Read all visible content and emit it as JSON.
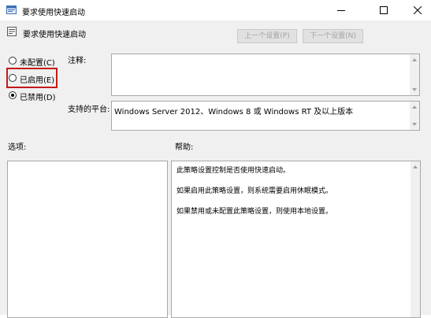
{
  "window": {
    "title": "要求使用快速启动",
    "controls": {
      "minimize": "minimize-icon",
      "maximize": "maximize-icon",
      "close": "close-icon"
    }
  },
  "header": {
    "policy_name": "要求使用快速启动",
    "prev_button": "上一个设置(P)",
    "next_button": "下一个设置(N)"
  },
  "state_options": [
    {
      "label": "未配置(C)",
      "checked": false
    },
    {
      "label": "已启用(E)",
      "checked": false
    },
    {
      "label": "已禁用(D)",
      "checked": true
    }
  ],
  "comment": {
    "label": "注释:",
    "value": ""
  },
  "supported": {
    "label": "支持的平台:",
    "value": "Windows Server 2012、Windows 8 或 Windows RT 及以上版本"
  },
  "options": {
    "label": "选项:"
  },
  "help": {
    "label": "帮助:",
    "lines": [
      "此策略设置控制是否使用快速启动。",
      "如果启用此策略设置，则系统需要启用休眠模式。",
      "如果禁用或未配置此策略设置，则使用本地设置。"
    ]
  },
  "colors": {
    "highlight": "#c41919",
    "disabled_text": "#a3a3a3"
  }
}
